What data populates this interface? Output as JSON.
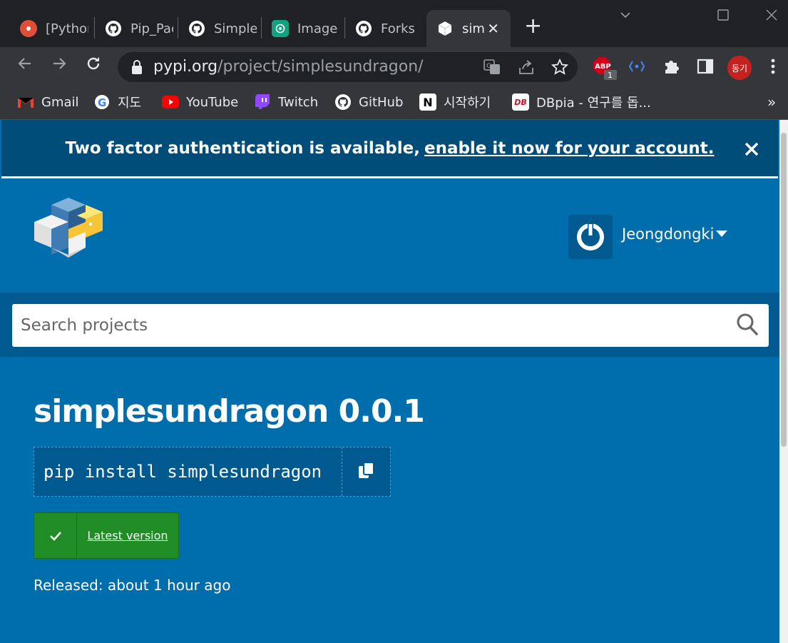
{
  "browser": {
    "tabs": [
      {
        "label": "[Python",
        "icon": "python-tab-icon",
        "color": "#e04e39"
      },
      {
        "label": "Pip_Pac",
        "icon": "github-icon",
        "color": "#ffffff"
      },
      {
        "label": "Simple",
        "icon": "github-icon",
        "color": "#ffffff"
      },
      {
        "label": "Image",
        "icon": "chatgpt-icon",
        "color": "#10a37f"
      },
      {
        "label": "Forks",
        "icon": "github-icon",
        "color": "#ffffff"
      },
      {
        "label": "sim",
        "icon": "pypi-box-icon",
        "color": "#ffffff",
        "active": true
      }
    ],
    "url_host": "pypi.org",
    "url_path": "/project/simplesundragon/",
    "abp_badge": "1",
    "abp_label": "ABP",
    "profile": "동기",
    "bookmarks": [
      {
        "label": "Gmail",
        "icon": "gmail-icon"
      },
      {
        "label": "지도",
        "icon": "google-icon"
      },
      {
        "label": "YouTube",
        "icon": "youtube-icon"
      },
      {
        "label": "Twitch",
        "icon": "twitch-icon"
      },
      {
        "label": "GitHub",
        "icon": "github-icon"
      },
      {
        "label": "시작하기",
        "icon": "notion-icon"
      },
      {
        "label": "DBpia - 연구를 돕...",
        "icon": "dbpia-icon"
      }
    ],
    "bookmark_overflow": "»"
  },
  "banner": {
    "text": "Two factor authentication is available,",
    "link": "enable it now for your account."
  },
  "header": {
    "username": "Jeongdongki"
  },
  "search": {
    "placeholder": "Search projects"
  },
  "project": {
    "title": "simplesundragon 0.0.1",
    "pip_command": "pip install simplesundragon",
    "latest_label": "Latest version",
    "released": "Released: about 1 hour ago"
  },
  "colors": {
    "pypi_blue": "#006dad",
    "pypi_dark": "#005a8f",
    "banner": "#004d7a",
    "green": "#1f8c25"
  }
}
